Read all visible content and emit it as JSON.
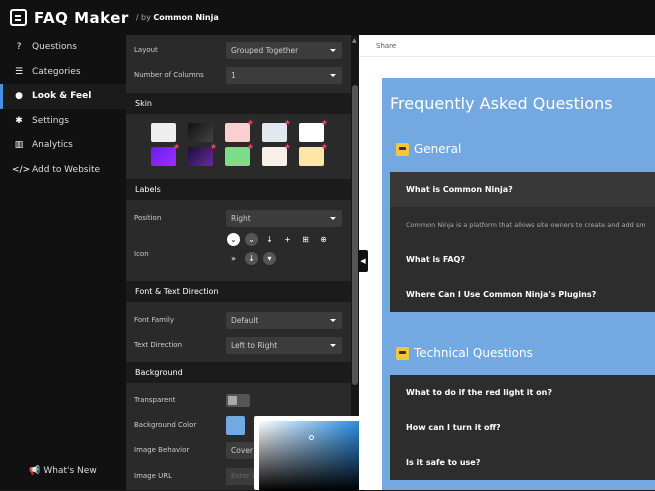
{
  "app": {
    "title": "FAQ Maker",
    "by_prefix": "/ by",
    "by_brand": "Common Ninja"
  },
  "sidebar": {
    "items": [
      {
        "label": "Questions",
        "icon": "?"
      },
      {
        "label": "Categories",
        "icon": "☰"
      },
      {
        "label": "Look & Feel",
        "icon": "●"
      },
      {
        "label": "Settings",
        "icon": "✱"
      },
      {
        "label": "Analytics",
        "icon": "▥"
      },
      {
        "label": "Add to Website",
        "icon": "</>"
      }
    ],
    "active_index": 2,
    "whats_new": "What's New"
  },
  "panel": {
    "layout": {
      "label": "Layout",
      "value": "Grouped Together"
    },
    "columns": {
      "label": "Number of Columns",
      "value": "1"
    },
    "skin_head": "Skin",
    "labels_head": "Labels",
    "position": {
      "label": "Position",
      "value": "Right"
    },
    "icon_label": "Icon",
    "font_head": "Font & Text Direction",
    "font_family": {
      "label": "Font Family",
      "value": "Default"
    },
    "text_direction": {
      "label": "Text Direction",
      "value": "Left to Right"
    },
    "background_head": "Background",
    "transparent_label": "Transparent",
    "bg_color_label": "Background Color",
    "bg_color": "#74a8e0",
    "image_behavior": {
      "label": "Image Behavior",
      "value": "Cover"
    },
    "image_url": {
      "label": "Image URL",
      "placeholder": "Enter i"
    }
  },
  "preview": {
    "top_label": "Share",
    "faq_title": "Frequently Asked Questions",
    "categories": [
      {
        "name": "General",
        "questions": [
          "What is Common Ninja?",
          "What is FAQ?",
          "Where Can I Use Common Ninja's Plugins?"
        ],
        "answer": "Common Ninja is a platform that allows site owners to create and add sm"
      },
      {
        "name": "Technical Questions",
        "questions": [
          "What to do if the red light it on?",
          "How can I turn it off?",
          "Is it safe to use?"
        ]
      }
    ]
  },
  "colors": {
    "accent": "#4a90e2",
    "faq_bg": "#74a8e0",
    "star": "#ff3c6c"
  }
}
